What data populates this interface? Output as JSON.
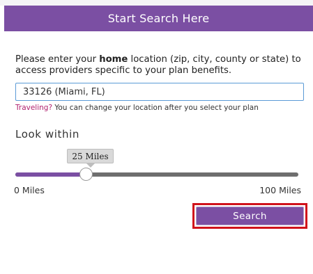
{
  "header": {
    "title": "Start Search Here"
  },
  "intro": {
    "prefix": "Please enter your ",
    "emphasis": "home",
    "suffix": " location (zip, city, county or state) to access providers specific to your plan benefits."
  },
  "location": {
    "value": "33126 (Miami, FL)"
  },
  "travel_note": {
    "link_text": "Traveling?",
    "text": " You can change your location after you select your plan"
  },
  "distance": {
    "heading": "Look within",
    "tooltip": "25 Miles",
    "min_label": "0 Miles",
    "max_label": "100 Miles",
    "fraction": 0.25
  },
  "actions": {
    "search_label": "Search"
  },
  "colors": {
    "brand_purple": "#7b4fa3",
    "link_magenta": "#b0206e",
    "highlight_red": "#d0121b",
    "field_border": "#5a9ad6"
  }
}
